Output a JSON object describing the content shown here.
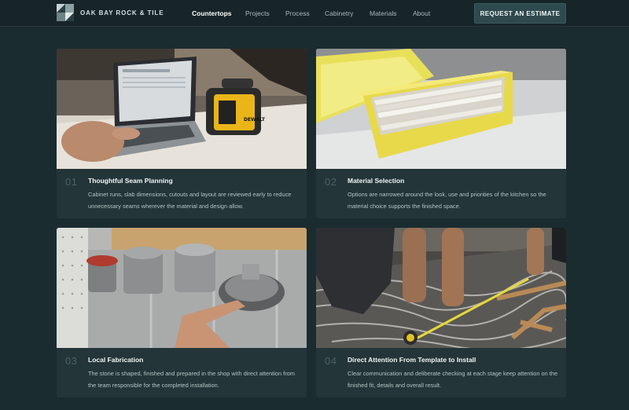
{
  "brand": {
    "name": "OAK BAY ROCK & TILE"
  },
  "nav": {
    "items": [
      "Countertops",
      "Projects",
      "Process",
      "Cabinetry",
      "Materials",
      "About"
    ],
    "active": "Countertops"
  },
  "cta": {
    "label": "REQUEST AN ESTIMATE"
  },
  "colors": {
    "background": "#1b2c30",
    "card": "#233539",
    "cta": "#2e4a4e",
    "number": "#4c6266"
  },
  "cards": [
    {
      "number": "01",
      "title": "Thoughtful Seam Planning",
      "description": "Cabinet runs, slab dimensions, cutouts and layout are reviewed early to reduce unnecessary seams wherever the material and design allow.",
      "image_label": "DEWALT"
    },
    {
      "number": "02",
      "title": "Material Selection",
      "description": "Options are narrowed around the look, use and priorities of the kitchen so the material choice supports the finished space."
    },
    {
      "number": "03",
      "title": "Local Fabrication",
      "description": "The stone is shaped, finished and prepared in the shop with direct attention from the team responsible for the completed installation."
    },
    {
      "number": "04",
      "title": "Direct Attention From Template to Install",
      "description": "Clear communication and deliberate checking at each stage keep attention on the finished fit, details and overall result."
    }
  ]
}
